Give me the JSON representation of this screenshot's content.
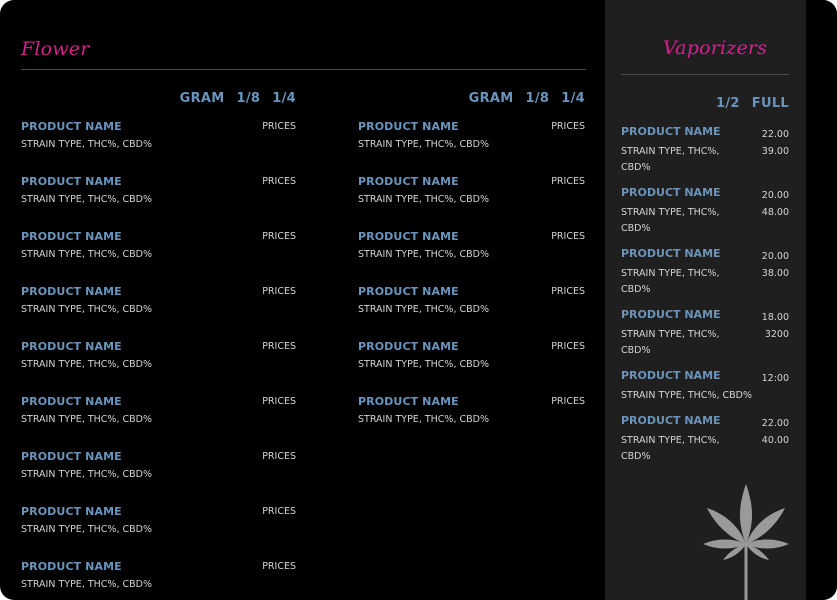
{
  "flower": {
    "title": "Flower",
    "columns": [
      {
        "headers": [
          "GRAM",
          "1/8",
          "1/4"
        ],
        "price_label": "PRICES"
      },
      {
        "headers": [
          "GRAM",
          "1/8",
          "1/4"
        ],
        "price_label": "PRICES"
      }
    ],
    "column1_items": [
      {
        "name": "PRODUCT NAME",
        "desc": "STRAIN TYPE, THC%, CBD%",
        "price": "PRICES"
      },
      {
        "name": "PRODUCT NAME",
        "desc": "STRAIN TYPE, THC%, CBD%",
        "price": "PRICES"
      },
      {
        "name": "PRODUCT NAME",
        "desc": "STRAIN TYPE, THC%, CBD%",
        "price": "PRICES"
      },
      {
        "name": "PRODUCT NAME",
        "desc": "STRAIN TYPE, THC%, CBD%",
        "price": "PRICES"
      },
      {
        "name": "PRODUCT NAME",
        "desc": "STRAIN TYPE, THC%, CBD%",
        "price": "PRICES"
      },
      {
        "name": "PRODUCT NAME",
        "desc": "STRAIN TYPE, THC%, CBD%",
        "price": "PRICES"
      },
      {
        "name": "PRODUCT NAME",
        "desc": "STRAIN TYPE, THC%, CBD%",
        "price": "PRICES"
      },
      {
        "name": "PRODUCT NAME",
        "desc": "STRAIN TYPE, THC%, CBD%",
        "price": "PRICES"
      },
      {
        "name": "PRODUCT NAME",
        "desc": "STRAIN TYPE, THC%, CBD%",
        "price": "PRICES"
      }
    ],
    "column2_items": [
      {
        "name": "PRODUCT NAME",
        "desc": "STRAIN TYPE, THC%, CBD%",
        "price": "PRICES"
      },
      {
        "name": "PRODUCT NAME",
        "desc": "STRAIN TYPE, THC%, CBD%",
        "price": "PRICES"
      },
      {
        "name": "PRODUCT NAME",
        "desc": "STRAIN TYPE, THC%, CBD%",
        "price": "PRICES"
      },
      {
        "name": "PRODUCT NAME",
        "desc": "STRAIN TYPE, THC%, CBD%",
        "price": "PRICES"
      },
      {
        "name": "PRODUCT NAME",
        "desc": "STRAIN TYPE, THC%, CBD%",
        "price": "PRICES"
      },
      {
        "name": "PRODUCT NAME",
        "desc": "STRAIN TYPE, THC%, CBD%",
        "price": "PRICES"
      }
    ]
  },
  "vaporizers": {
    "title": "Vaporizers",
    "headers": [
      "1/2",
      "FULL"
    ],
    "items": [
      {
        "name": "PRODUCT NAME",
        "desc": "STRAIN TYPE, THC%, CBD%",
        "prices": [
          "22.00",
          "39.00"
        ]
      },
      {
        "name": "PRODUCT NAME",
        "desc": "STRAIN TYPE, THC%, CBD%",
        "prices": [
          "20.00",
          "48.00"
        ]
      },
      {
        "name": "PRODUCT NAME",
        "desc": "STRAIN TYPE, THC%, CBD%",
        "prices": [
          "20.00",
          "38.00"
        ]
      },
      {
        "name": "PRODUCT NAME",
        "desc": "STRAIN TYPE, THC%, CBD%",
        "prices": [
          "18.00",
          "3200"
        ]
      },
      {
        "name": "PRODUCT NAME",
        "desc": "STRAIN TYPE, THC%, CBD%",
        "prices": [
          "12:00"
        ]
      },
      {
        "name": "PRODUCT NAME",
        "desc": "STRAIN TYPE, THC%, CBD%",
        "prices": [
          "22.00",
          "40.00"
        ]
      }
    ]
  },
  "colors": {
    "accent": "#d6208f",
    "product_name": "#6a94bb",
    "sidebar_bg": "#1f1f1f",
    "leaf": "#9a9a9a"
  },
  "icons": {
    "decoration": "cannabis-leaf-icon"
  }
}
